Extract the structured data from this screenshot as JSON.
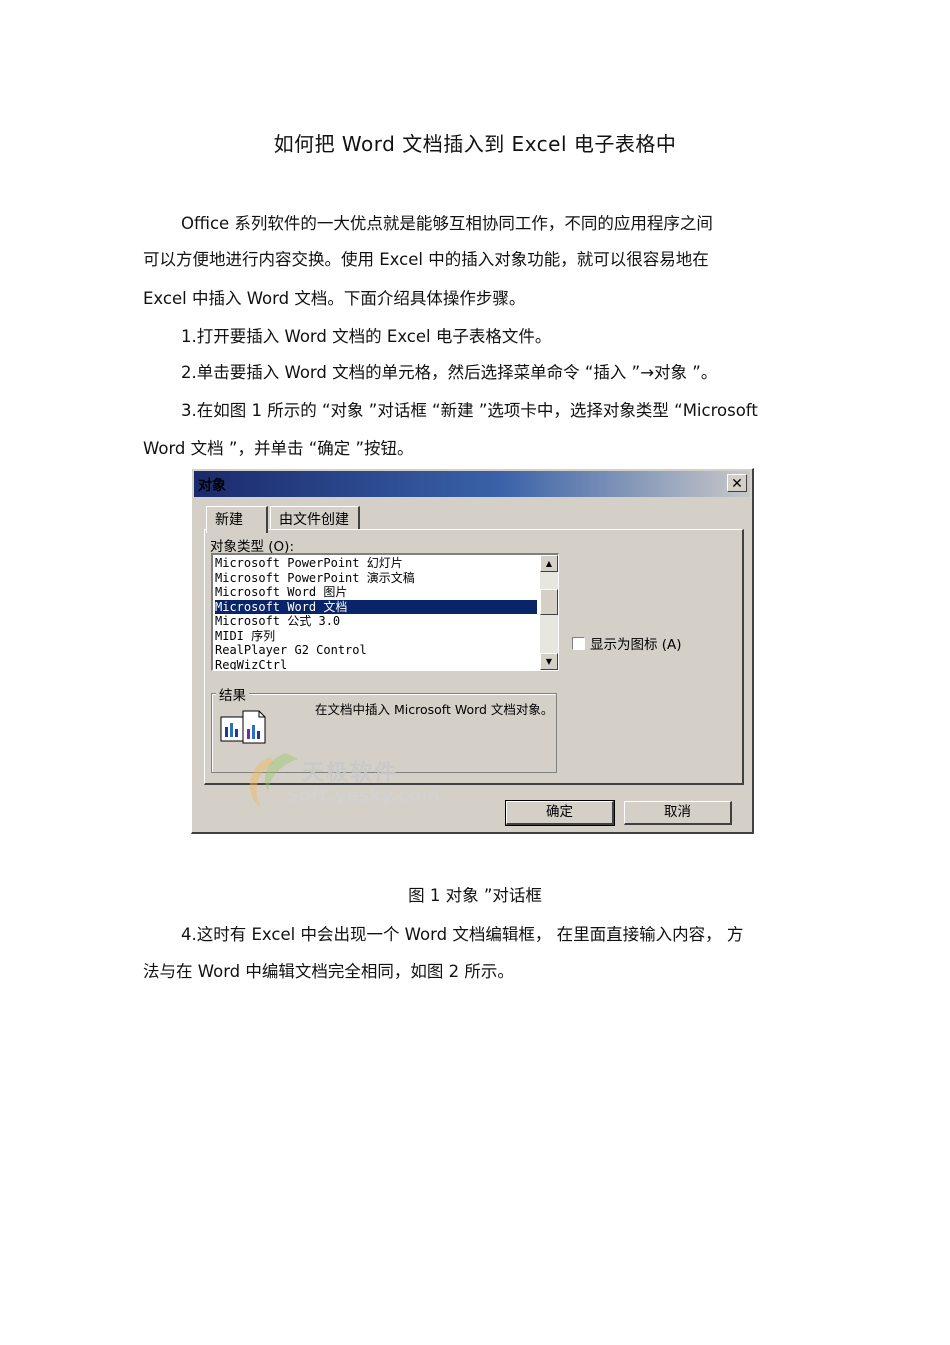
{
  "document": {
    "title": "如何把  Word  文档插入到   Excel  电子表格中",
    "para1": [
      "Office  系列软件的一大优点就是能够互相协同工作，不同的应用程序之间",
      "可以方便地进行内容交换。使用    Excel  中的插入对象功能，就可以很容易地在",
      "Excel  中插入  Word  文档。下面介绍具体操作步骤。"
    ],
    "step1": "1.打开要插入  Word  文档的  Excel  电子表格文件。",
    "step2": "2.单击要插入  Word  文档的单元格，然后选择菜单命令    “插入 ”→对象 ”。",
    "step3": [
      "3.在如图 1 所示的 “对象 ”对话框 “新建 ”选项卡中，选择对象类型   “Microsoft",
      "Word  文档 ”，并单击 “确定 ”按钮。"
    ],
    "caption": "图 1  对象 ”对话框",
    "step4": [
      "4.这时有  Excel  中会出现一个   Word  文档编辑框，  在里面直接输入内容，   方",
      "法与在  Word  中编辑文档完全相同，如图    2 所示。"
    ]
  },
  "dialog": {
    "title": "对象",
    "close_glyph": "✕",
    "tabs": [
      {
        "label": "新建"
      },
      {
        "label": "由文件创建"
      }
    ],
    "object_type_label": "对象类型 (O):",
    "object_types": [
      "Microsoft PowerPoint 幻灯片",
      "Microsoft PowerPoint 演示文稿",
      "Microsoft Word 图片",
      "Microsoft Word 文档",
      "Microsoft 公式 3.0",
      "MIDI 序列",
      "RealPlayer G2 Control",
      "RegWizCtrl"
    ],
    "selected_index": 3,
    "display_as_icon_label": "显示为图标 (A)",
    "result_label": "结果",
    "result_text": "在文档中插入 Microsoft Word 文档对象。",
    "ok_label": "确定",
    "cancel_label": "取消",
    "watermark_cn": "天极软件",
    "watermark_en": "Soft.yesky.com",
    "scroll_up_glyph": "▲",
    "scroll_down_glyph": "▼"
  },
  "colors": {
    "selection": "#0a246a",
    "dialog_face": "#d4d0c8"
  }
}
